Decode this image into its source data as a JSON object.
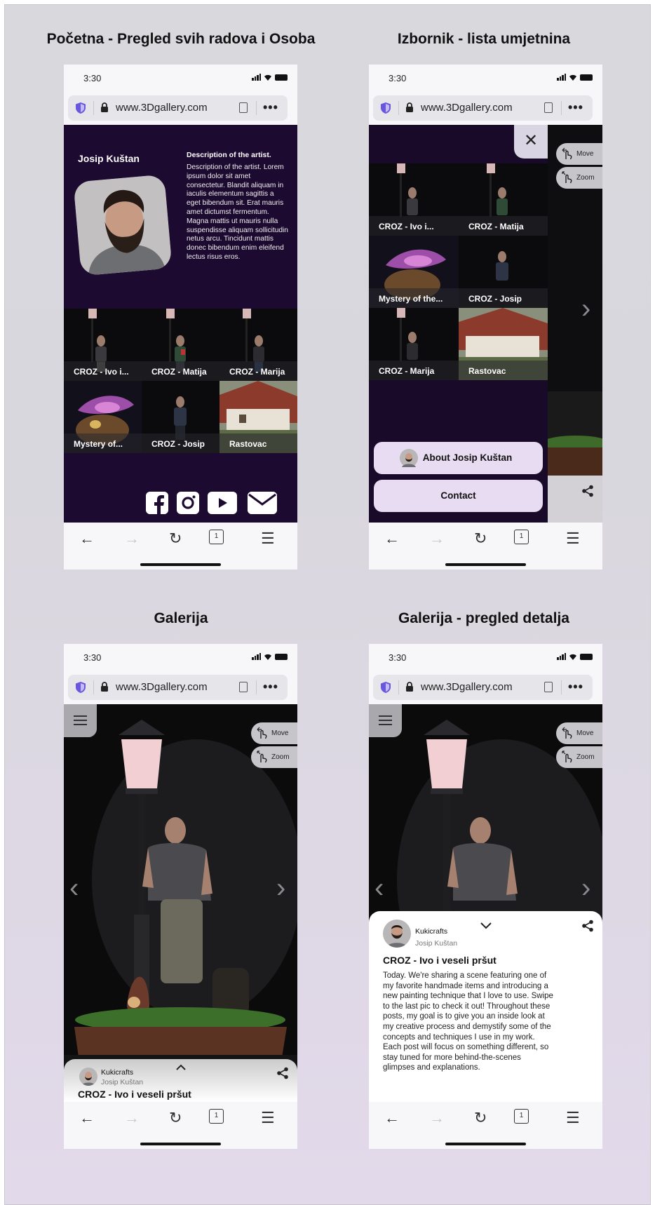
{
  "screens": {
    "home": {
      "title": "Početna - Pregled svih radova i Osoba"
    },
    "menu": {
      "title": "Izbornik - lista umjetnina"
    },
    "gallery": {
      "title": "Galerija"
    },
    "detail": {
      "title": "Galerija - pregled detalja"
    }
  },
  "browser": {
    "time": "3:30",
    "url": "www.3Dgallery.com",
    "more": "•••",
    "tab_count": "1",
    "back": "←",
    "forward": "→",
    "reload": "↻",
    "menu": "☰"
  },
  "artist": {
    "name": "Josip Kuštan",
    "description_title": "Description of the artist.",
    "description": "Description of the artist. Lorem ipsum dolor sit amet consectetur. Blandit aliquam in iaculis elementum sagittis a eget bibendum sit. Erat mauris amet dictumst fermentum. Magna mattis ut mauris nulla suspendisse aliquam sollicitudin netus arcu. Tincidunt mattis donec bibendum enim eleifend lectus risus eros."
  },
  "works_home": [
    "CROZ - Ivo i...",
    "CROZ - Matija",
    "CROZ - Marija",
    "Mystery of...",
    "CROZ - Josip",
    "Rastovac"
  ],
  "works_menu": [
    "CROZ - Ivo i...",
    "CROZ - Matija",
    "Mystery of the...",
    "CROZ - Josip",
    "CROZ - Marija",
    "Rastovac"
  ],
  "social": [
    "facebook-icon",
    "instagram-icon",
    "youtube-icon",
    "mail-icon"
  ],
  "menu_buttons": {
    "about": "About Josip Kuštan",
    "contact": "Contact",
    "close": "✕"
  },
  "controls": {
    "move": "Move",
    "zoom": "Zoom"
  },
  "post": {
    "username": "Kukicrafts",
    "author": "Josip Kuštan",
    "title": "CROZ - Ivo i veseli pršut",
    "text": "Today. We're sharing a scene featuring one of my favorite handmade items and introducing a new painting technique that I love to use. Swipe to the last pic to check it out! Throughout these posts, my goal is to give you an inside look at my creative process and demystify some of the concepts and techniques I use in my work. Each post will focus on something different, so stay tuned for more behind-the-scenes glimpses and explanations."
  }
}
